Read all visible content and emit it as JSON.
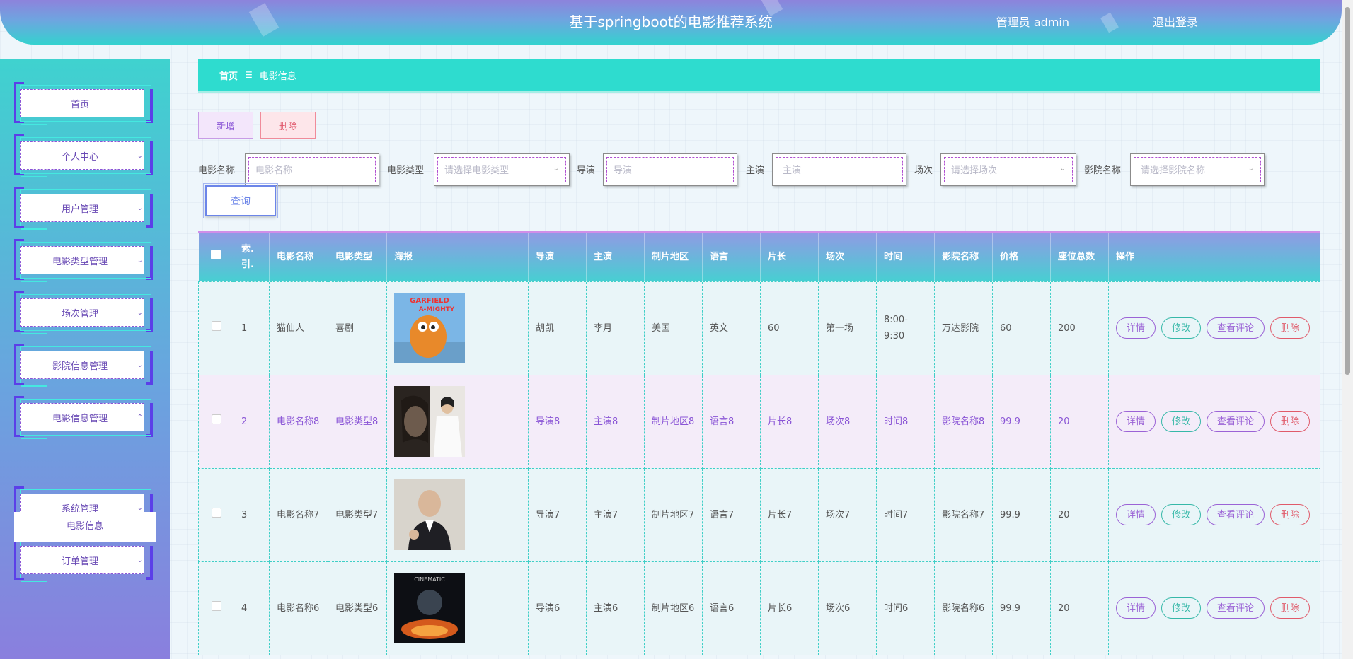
{
  "header": {
    "title": "基于springboot的电影推荐系统",
    "user": "管理员 admin",
    "logout": "退出登录"
  },
  "sidebar": {
    "items": [
      {
        "label": "首页",
        "has_chevron": false
      },
      {
        "label": "个人中心",
        "has_chevron": true
      },
      {
        "label": "用户管理",
        "has_chevron": true
      },
      {
        "label": "电影类型管理",
        "has_chevron": true
      },
      {
        "label": "场次管理",
        "has_chevron": true
      },
      {
        "label": "影院信息管理",
        "has_chevron": true
      },
      {
        "label": "电影信息管理",
        "has_chevron": true,
        "expanded": true
      },
      {
        "label": "系统管理",
        "has_chevron": true
      },
      {
        "label": "订单管理",
        "has_chevron": true
      }
    ],
    "sub_item": "电影信息"
  },
  "breadcrumb": {
    "home": "首页",
    "separator": "☰",
    "current": "电影信息"
  },
  "actions": {
    "add": "新增",
    "delete": "删除",
    "search": "查询"
  },
  "filters": [
    {
      "label": "电影名称",
      "placeholder": "电影名称",
      "type": "input"
    },
    {
      "label": "电影类型",
      "placeholder": "请选择电影类型",
      "type": "select"
    },
    {
      "label": "导演",
      "placeholder": "导演",
      "type": "input"
    },
    {
      "label": "主演",
      "placeholder": "主演",
      "type": "input"
    },
    {
      "label": "场次",
      "placeholder": "请选择场次",
      "type": "select"
    },
    {
      "label": "影院名称",
      "placeholder": "请选择影院名称",
      "type": "select"
    }
  ],
  "table": {
    "headers": [
      "索引",
      "电影名称",
      "电影类型",
      "海报",
      "导演",
      "主演",
      "制片地区",
      "语言",
      "片长",
      "场次",
      "时间",
      "影院名称",
      "价格",
      "座位总数",
      "操作"
    ],
    "header_display": [
      "索.引.",
      "电影名称",
      "电影类型",
      "海报",
      "导演",
      "主演",
      "制片地区",
      "语言",
      "片长",
      "场次",
      "时间",
      "影院名称",
      "价格",
      "座位总数",
      "操作"
    ],
    "rows": [
      {
        "index": "1",
        "name": "猫仙人",
        "type": "喜剧",
        "poster": "cat-poster",
        "director": "胡凯",
        "star": "李月",
        "region": "美国",
        "language": "英文",
        "length": "60",
        "session": "第一场",
        "time": "8:00-9:30",
        "cinema": "万达影院",
        "price": "60",
        "seats": "200"
      },
      {
        "index": "2",
        "name": "电影名称8",
        "type": "电影类型8",
        "poster": "woman-poster",
        "director": "导演8",
        "star": "主演8",
        "region": "制片地区8",
        "language": "语言8",
        "length": "片长8",
        "session": "场次8",
        "time": "时间8",
        "cinema": "影院名称8",
        "price": "99.9",
        "seats": "20"
      },
      {
        "index": "3",
        "name": "电影名称7",
        "type": "电影类型7",
        "poster": "man-poster",
        "director": "导演7",
        "star": "主演7",
        "region": "制片地区7",
        "language": "语言7",
        "length": "片长7",
        "session": "场次7",
        "time": "时间7",
        "cinema": "影院名称7",
        "price": "99.9",
        "seats": "20"
      },
      {
        "index": "4",
        "name": "电影名称6",
        "type": "电影类型6",
        "poster": "cinematic-poster",
        "director": "导演6",
        "star": "主演6",
        "region": "制片地区6",
        "language": "语言6",
        "length": "片长6",
        "session": "场次6",
        "time": "时间6",
        "cinema": "影院名称6",
        "price": "99.9",
        "seats": "20"
      }
    ],
    "row_actions": {
      "detail": "详情",
      "edit": "修改",
      "review": "查看评论",
      "delete": "删除"
    }
  },
  "poster_text": {
    "cat-poster": "GARFIELD A-MIGHTY",
    "cinematic-poster": "CINEMATIC"
  },
  "colors": {
    "accent_cyan": "#2edccf",
    "accent_purple": "#8a55d6",
    "danger": "#e05a6a",
    "edit": "#36b8a8"
  }
}
